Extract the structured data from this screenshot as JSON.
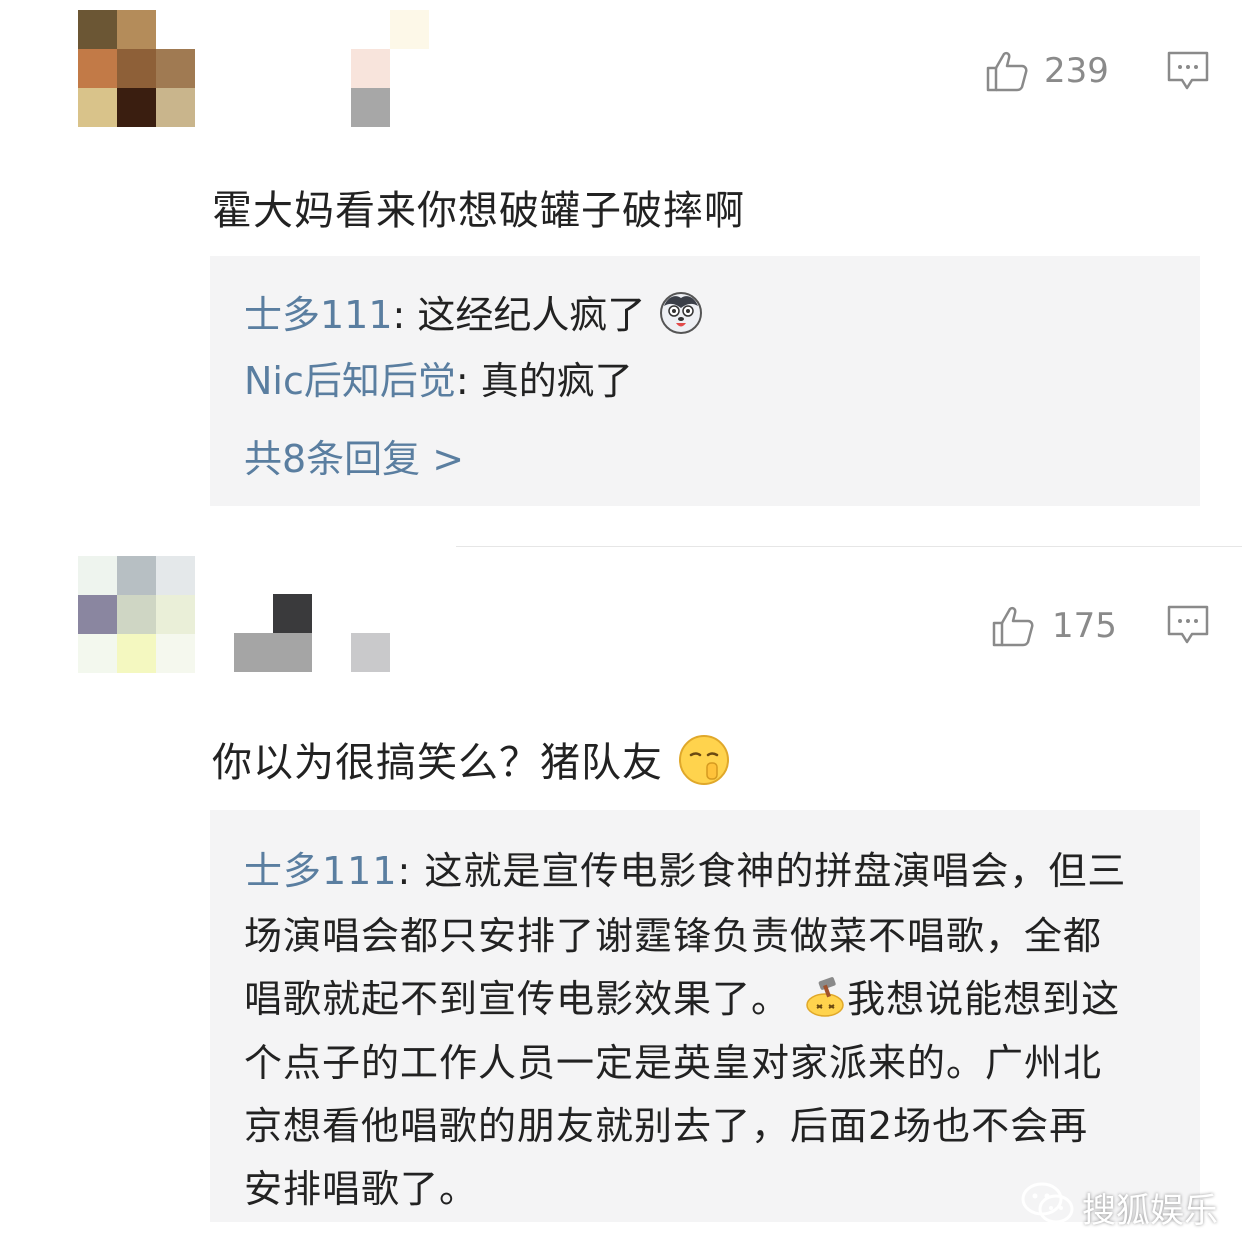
{
  "comments": [
    {
      "likes": "239",
      "text": "霍大妈看来你想破罐子破摔啊",
      "replies": [
        {
          "user": "士多111",
          "sep": ": ",
          "text": "这经纪人疯了"
        },
        {
          "user": "Nic后知后觉",
          "sep": ": ",
          "text": "真的疯了"
        }
      ],
      "more_replies": "共8条回复 >"
    },
    {
      "likes": "175",
      "text": "你以为很搞笑么？猪队友",
      "reply": {
        "user": "士多111",
        "sep": ": ",
        "lines": [
          "这就是宣传电影食神的拼盘演唱会，但三",
          "场演唱会都只安排了谢霆锋负责做菜不唱歌，全都",
          "唱歌就起不到宣传电影效果了。",
          "我想说能想到这",
          "个点子的工作人员一定是英皇对家派来的。广州北",
          "京想看他唱歌的朋友就别去了，后面2场也不会再",
          "安排唱歌了。"
        ]
      }
    }
  ],
  "icons": {
    "like": "thumbs-up-icon",
    "comment": "comment-bubble-icon",
    "emoji_husky": "husky-emoji-icon",
    "emoji_shush": "shush-emoji-icon",
    "emoji_gavel": "gavel-emoji-icon",
    "watermark": "wechat-logo-icon"
  },
  "colors": {
    "username": "#5a7ea0",
    "reply_bg": "#f4f4f5",
    "meta": "#8a8a8a"
  },
  "watermark": "搜狐娱乐"
}
